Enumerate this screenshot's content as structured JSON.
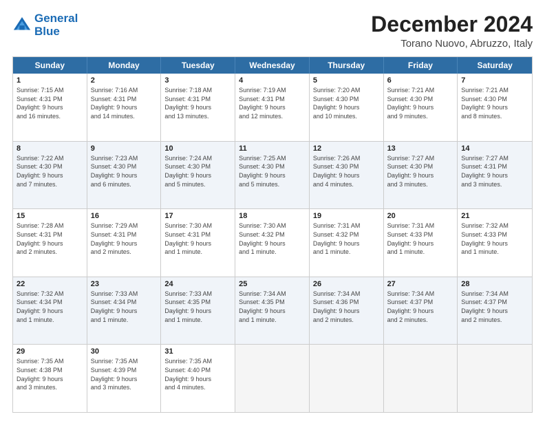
{
  "logo": {
    "line1": "General",
    "line2": "Blue"
  },
  "title": "December 2024",
  "location": "Torano Nuovo, Abruzzo, Italy",
  "weekdays": [
    "Sunday",
    "Monday",
    "Tuesday",
    "Wednesday",
    "Thursday",
    "Friday",
    "Saturday"
  ],
  "rows": [
    [
      {
        "day": "1",
        "info": "Sunrise: 7:15 AM\nSunset: 4:31 PM\nDaylight: 9 hours\nand 16 minutes."
      },
      {
        "day": "2",
        "info": "Sunrise: 7:16 AM\nSunset: 4:31 PM\nDaylight: 9 hours\nand 14 minutes."
      },
      {
        "day": "3",
        "info": "Sunrise: 7:18 AM\nSunset: 4:31 PM\nDaylight: 9 hours\nand 13 minutes."
      },
      {
        "day": "4",
        "info": "Sunrise: 7:19 AM\nSunset: 4:31 PM\nDaylight: 9 hours\nand 12 minutes."
      },
      {
        "day": "5",
        "info": "Sunrise: 7:20 AM\nSunset: 4:30 PM\nDaylight: 9 hours\nand 10 minutes."
      },
      {
        "day": "6",
        "info": "Sunrise: 7:21 AM\nSunset: 4:30 PM\nDaylight: 9 hours\nand 9 minutes."
      },
      {
        "day": "7",
        "info": "Sunrise: 7:21 AM\nSunset: 4:30 PM\nDaylight: 9 hours\nand 8 minutes."
      }
    ],
    [
      {
        "day": "8",
        "info": "Sunrise: 7:22 AM\nSunset: 4:30 PM\nDaylight: 9 hours\nand 7 minutes."
      },
      {
        "day": "9",
        "info": "Sunrise: 7:23 AM\nSunset: 4:30 PM\nDaylight: 9 hours\nand 6 minutes."
      },
      {
        "day": "10",
        "info": "Sunrise: 7:24 AM\nSunset: 4:30 PM\nDaylight: 9 hours\nand 5 minutes."
      },
      {
        "day": "11",
        "info": "Sunrise: 7:25 AM\nSunset: 4:30 PM\nDaylight: 9 hours\nand 5 minutes."
      },
      {
        "day": "12",
        "info": "Sunrise: 7:26 AM\nSunset: 4:30 PM\nDaylight: 9 hours\nand 4 minutes."
      },
      {
        "day": "13",
        "info": "Sunrise: 7:27 AM\nSunset: 4:30 PM\nDaylight: 9 hours\nand 3 minutes."
      },
      {
        "day": "14",
        "info": "Sunrise: 7:27 AM\nSunset: 4:31 PM\nDaylight: 9 hours\nand 3 minutes."
      }
    ],
    [
      {
        "day": "15",
        "info": "Sunrise: 7:28 AM\nSunset: 4:31 PM\nDaylight: 9 hours\nand 2 minutes."
      },
      {
        "day": "16",
        "info": "Sunrise: 7:29 AM\nSunset: 4:31 PM\nDaylight: 9 hours\nand 2 minutes."
      },
      {
        "day": "17",
        "info": "Sunrise: 7:30 AM\nSunset: 4:31 PM\nDaylight: 9 hours\nand 1 minute."
      },
      {
        "day": "18",
        "info": "Sunrise: 7:30 AM\nSunset: 4:32 PM\nDaylight: 9 hours\nand 1 minute."
      },
      {
        "day": "19",
        "info": "Sunrise: 7:31 AM\nSunset: 4:32 PM\nDaylight: 9 hours\nand 1 minute."
      },
      {
        "day": "20",
        "info": "Sunrise: 7:31 AM\nSunset: 4:33 PM\nDaylight: 9 hours\nand 1 minute."
      },
      {
        "day": "21",
        "info": "Sunrise: 7:32 AM\nSunset: 4:33 PM\nDaylight: 9 hours\nand 1 minute."
      }
    ],
    [
      {
        "day": "22",
        "info": "Sunrise: 7:32 AM\nSunset: 4:34 PM\nDaylight: 9 hours\nand 1 minute."
      },
      {
        "day": "23",
        "info": "Sunrise: 7:33 AM\nSunset: 4:34 PM\nDaylight: 9 hours\nand 1 minute."
      },
      {
        "day": "24",
        "info": "Sunrise: 7:33 AM\nSunset: 4:35 PM\nDaylight: 9 hours\nand 1 minute."
      },
      {
        "day": "25",
        "info": "Sunrise: 7:34 AM\nSunset: 4:35 PM\nDaylight: 9 hours\nand 1 minute."
      },
      {
        "day": "26",
        "info": "Sunrise: 7:34 AM\nSunset: 4:36 PM\nDaylight: 9 hours\nand 2 minutes."
      },
      {
        "day": "27",
        "info": "Sunrise: 7:34 AM\nSunset: 4:37 PM\nDaylight: 9 hours\nand 2 minutes."
      },
      {
        "day": "28",
        "info": "Sunrise: 7:34 AM\nSunset: 4:37 PM\nDaylight: 9 hours\nand 2 minutes."
      }
    ],
    [
      {
        "day": "29",
        "info": "Sunrise: 7:35 AM\nSunset: 4:38 PM\nDaylight: 9 hours\nand 3 minutes."
      },
      {
        "day": "30",
        "info": "Sunrise: 7:35 AM\nSunset: 4:39 PM\nDaylight: 9 hours\nand 3 minutes."
      },
      {
        "day": "31",
        "info": "Sunrise: 7:35 AM\nSunset: 4:40 PM\nDaylight: 9 hours\nand 4 minutes."
      },
      {
        "day": "",
        "info": ""
      },
      {
        "day": "",
        "info": ""
      },
      {
        "day": "",
        "info": ""
      },
      {
        "day": "",
        "info": ""
      }
    ]
  ]
}
